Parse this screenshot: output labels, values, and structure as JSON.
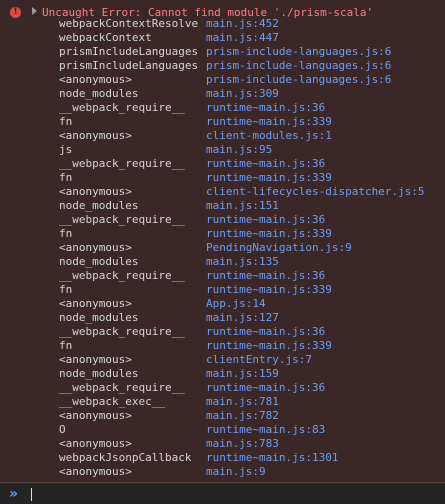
{
  "error": {
    "icon": "error-icon",
    "message": "Uncaught Error: Cannot find module './prism-scala'"
  },
  "stack": [
    {
      "fn": "webpackContextResolve",
      "loc": "main.js:452"
    },
    {
      "fn": "webpackContext",
      "loc": "main.js:447"
    },
    {
      "fn": "prismIncludeLanguages",
      "loc": "prism-include-languages.js:6"
    },
    {
      "fn": "prismIncludeLanguages",
      "loc": "prism-include-languages.js:6"
    },
    {
      "fn": "<anonymous>",
      "loc": "prism-include-languages.js:6"
    },
    {
      "fn": "node_modules",
      "loc": "main.js:309"
    },
    {
      "fn": "__webpack_require__",
      "loc": "runtime~main.js:36"
    },
    {
      "fn": "fn",
      "loc": "runtime~main.js:339"
    },
    {
      "fn": "<anonymous>",
      "loc": "client-modules.js:1"
    },
    {
      "fn": "js",
      "loc": "main.js:95"
    },
    {
      "fn": "__webpack_require__",
      "loc": "runtime~main.js:36"
    },
    {
      "fn": "fn",
      "loc": "runtime~main.js:339"
    },
    {
      "fn": "<anonymous>",
      "loc": "client-lifecycles-dispatcher.js:5"
    },
    {
      "fn": "node_modules",
      "loc": "main.js:151"
    },
    {
      "fn": "__webpack_require__",
      "loc": "runtime~main.js:36"
    },
    {
      "fn": "fn",
      "loc": "runtime~main.js:339"
    },
    {
      "fn": "<anonymous>",
      "loc": "PendingNavigation.js:9"
    },
    {
      "fn": "node_modules",
      "loc": "main.js:135"
    },
    {
      "fn": "__webpack_require__",
      "loc": "runtime~main.js:36"
    },
    {
      "fn": "fn",
      "loc": "runtime~main.js:339"
    },
    {
      "fn": "<anonymous>",
      "loc": "App.js:14"
    },
    {
      "fn": "node_modules",
      "loc": "main.js:127"
    },
    {
      "fn": "__webpack_require__",
      "loc": "runtime~main.js:36"
    },
    {
      "fn": "fn",
      "loc": "runtime~main.js:339"
    },
    {
      "fn": "<anonymous>",
      "loc": "clientEntry.js:7"
    },
    {
      "fn": "node_modules",
      "loc": "main.js:159"
    },
    {
      "fn": "__webpack_require__",
      "loc": "runtime~main.js:36"
    },
    {
      "fn": "__webpack_exec__",
      "loc": "main.js:781"
    },
    {
      "fn": "<anonymous>",
      "loc": "main.js:782"
    },
    {
      "fn": "O",
      "loc": "runtime~main.js:83"
    },
    {
      "fn": "<anonymous>",
      "loc": "main.js:783"
    },
    {
      "fn": "webpackJsonpCallback",
      "loc": "runtime~main.js:1301"
    },
    {
      "fn": "<anonymous>",
      "loc": "main.js:9"
    }
  ],
  "prompt": {
    "icon": "console-prompt-chevron-icon",
    "value": ""
  }
}
